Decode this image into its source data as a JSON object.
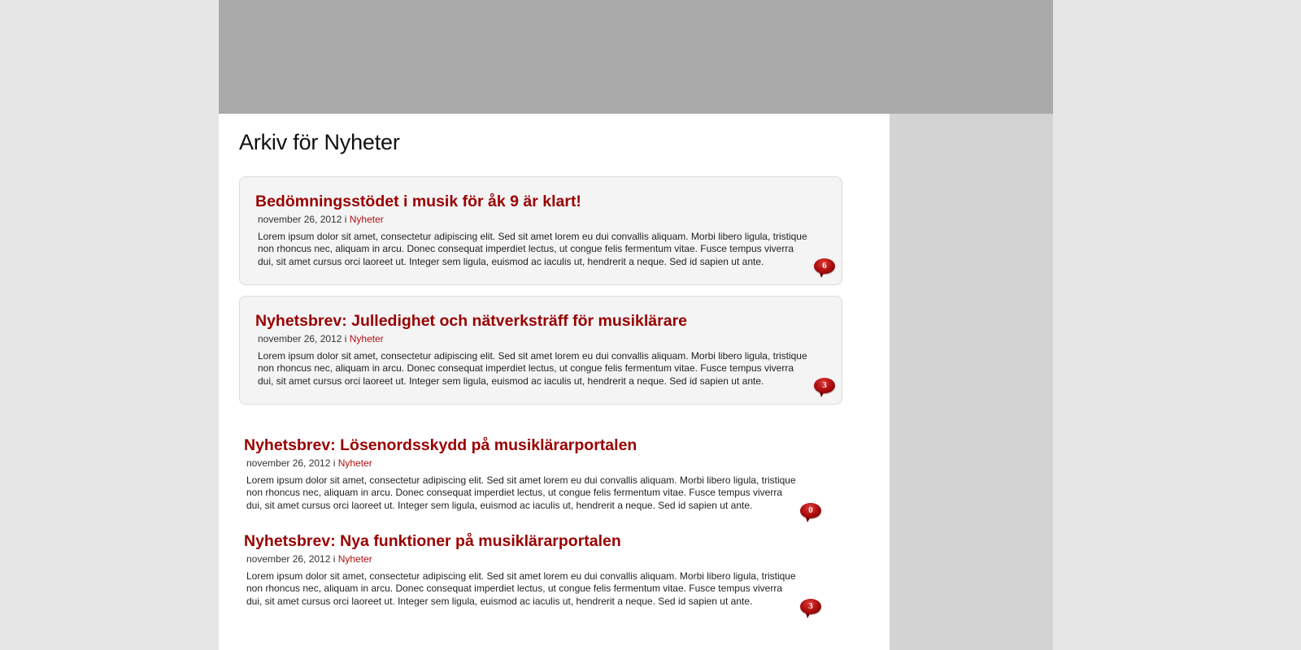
{
  "archive": {
    "title": "Arkiv för Nyheter"
  },
  "posts": [
    {
      "title": "Bedömningsstödet i musik för åk 9 är klart!",
      "date": "november 26, 2012",
      "in": "i",
      "category": "Nyheter",
      "excerpt": "Lorem ipsum dolor sit amet, consectetur adipiscing elit. Sed sit amet lorem eu dui convallis aliquam. Morbi libero ligula, tristique non rhoncus nec, aliquam in arcu. Donec consequat imperdiet lectus, ut congue felis fermentum vitae. Fusce tempus viverra dui, sit amet cursus orci laoreet ut. Integer sem ligula, euismod ac iaculis ut, hendrerit a neque. Sed id sapien ut ante.",
      "comments": "6"
    },
    {
      "title": "Nyhetsbrev: Julledighet och nätverksträff för musiklärare",
      "date": "november 26, 2012",
      "in": "i",
      "category": "Nyheter",
      "excerpt": "Lorem ipsum dolor sit amet, consectetur adipiscing elit. Sed sit amet lorem eu dui convallis aliquam. Morbi libero ligula, tristique non rhoncus nec, aliquam in arcu. Donec consequat imperdiet lectus, ut congue felis fermentum vitae. Fusce tempus viverra dui, sit amet cursus orci laoreet ut. Integer sem ligula, euismod ac iaculis ut, hendrerit a neque. Sed id sapien ut ante.",
      "comments": "3"
    },
    {
      "title": "Nyhetsbrev: Lösenordsskydd på musiklärarportalen",
      "date": "november 26, 2012",
      "in": "i",
      "category": "Nyheter",
      "excerpt": "Lorem ipsum dolor sit amet, consectetur adipiscing elit. Sed sit amet lorem eu dui convallis aliquam. Morbi libero ligula, tristique non rhoncus nec, aliquam in arcu. Donec consequat imperdiet lectus, ut congue felis fermentum vitae. Fusce tempus viverra dui, sit amet cursus orci laoreet ut. Integer sem ligula, euismod ac iaculis ut, hendrerit a neque. Sed id sapien ut ante.",
      "comments": "0"
    },
    {
      "title": "Nyhetsbrev: Nya funktioner på musiklärarportalen",
      "date": "november 26, 2012",
      "in": "i",
      "category": "Nyheter",
      "excerpt": "Lorem ipsum dolor sit amet, consectetur adipiscing elit. Sed sit amet lorem eu dui convallis aliquam. Morbi libero ligula, tristique non rhoncus nec, aliquam in arcu. Donec consequat imperdiet lectus, ut congue felis fermentum vitae. Fusce tempus viverra dui, sit amet cursus orci laoreet ut. Integer sem ligula, euismod ac iaculis ut, hendrerit a neque. Sed id sapien ut ante.",
      "comments": "3"
    }
  ],
  "colors": {
    "page_background": "#e6e6e6",
    "header_banner": "#aaaaaa",
    "sidebar": "#d3d3d3",
    "post_title": "#990000",
    "category_link": "#b01010",
    "comment_bubble": "#a80b0b"
  },
  "icons": {
    "comment_count": "speech-bubble-icon"
  }
}
